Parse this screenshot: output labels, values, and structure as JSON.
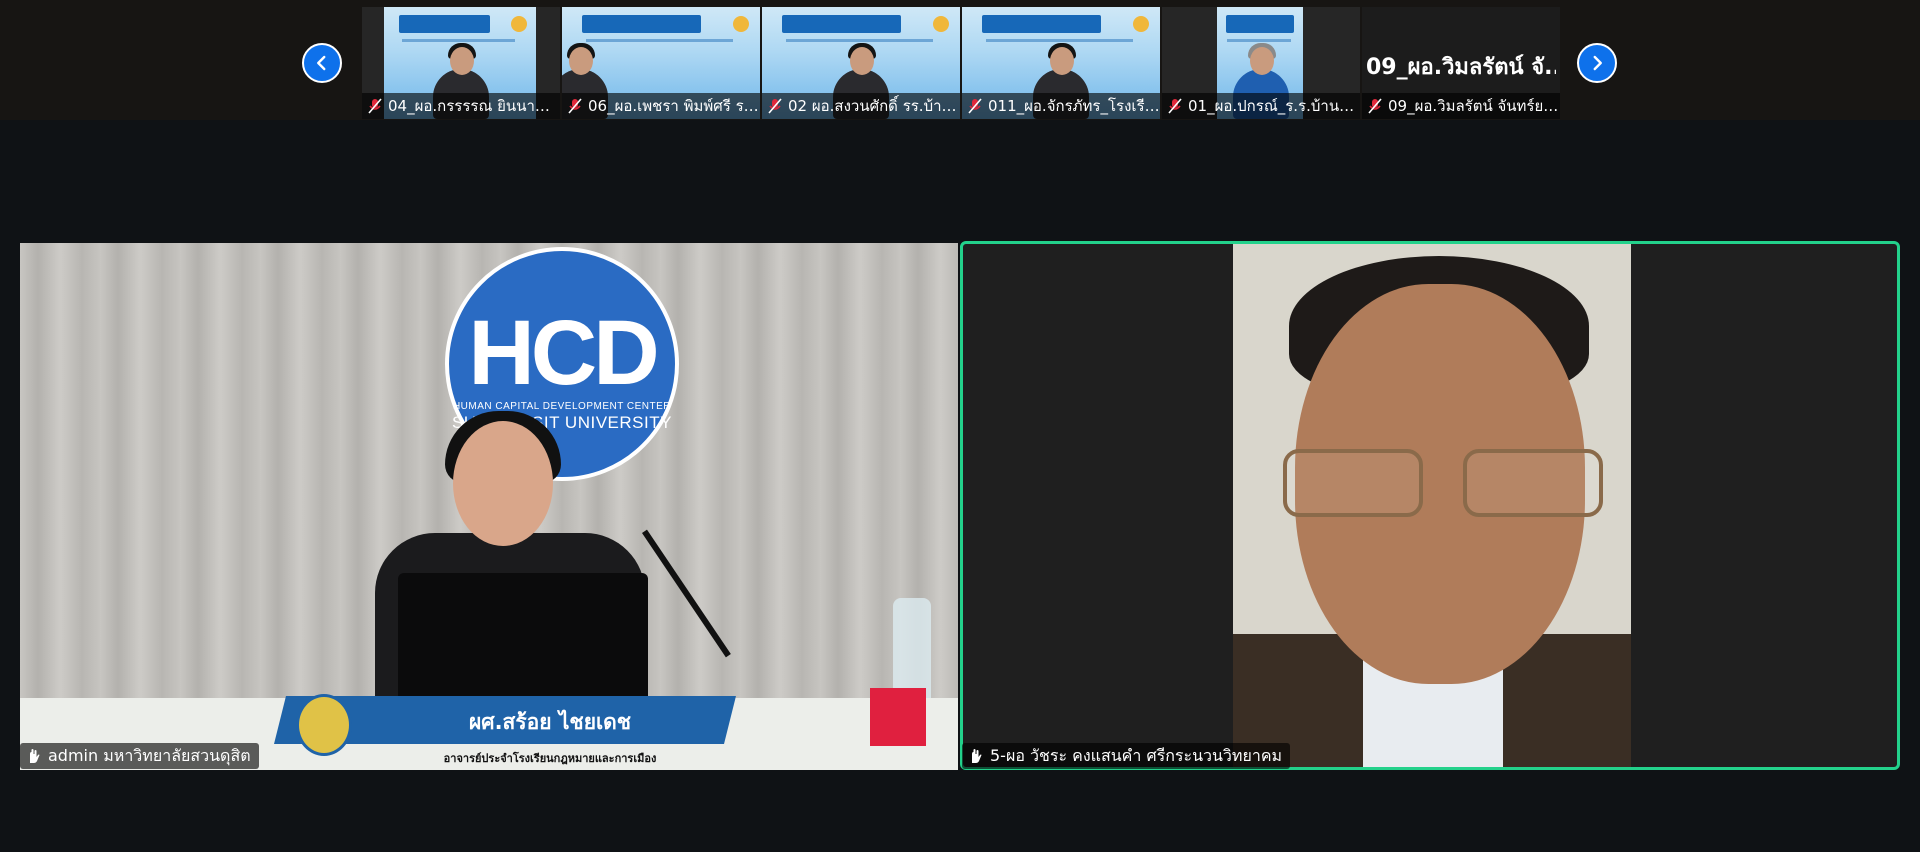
{
  "filmstrip": {
    "participants": [
      {
        "name": "04_ผอ.กรรรรณ ยินนาน_...",
        "muted": true,
        "kind": "slide-person"
      },
      {
        "name": "06_ผอ.เพชรา พิมพ์ศรี ร.ร...",
        "muted": true,
        "kind": "slide"
      },
      {
        "name": "02 ผอ.สงวนศักดิ์ รร.บ้านโ...",
        "muted": true,
        "kind": "slide-person"
      },
      {
        "name": "011_ผอ.จักรภัทร_โรงเรีย...",
        "muted": true,
        "kind": "slide-person"
      },
      {
        "name": "01_ผอ.ปกรณ์_ร.ร.บ้านสว้า",
        "muted": true,
        "kind": "slide-person"
      },
      {
        "name": "09_ผอ.วิมลรัตน์ จันทร์ยาง...",
        "muted": true,
        "kind": "name-only",
        "big_name": "09_ผอ.วิมลรัตน์ จั..."
      }
    ]
  },
  "main_left": {
    "label": "admin มหาวิทยาลัยสวนดุสิต",
    "logo": {
      "text": "HCD",
      "sub1": "HUMAN CAPITAL DEVELOPMENT CENTER",
      "sub2": "SUAN DUSIT UNIVERSITY"
    },
    "nameplate": {
      "name": "ผศ.สร้อย  ไชยเดช",
      "role": "อาจารย์ประจำโรงเรียนกฎหมายและการเมือง"
    }
  },
  "main_right": {
    "label": "5-ผอ วัชระ คงแสนคำ ศรีกระนวนวิทยาคม",
    "active_speaker": true
  },
  "colors": {
    "accent": "#0e71eb",
    "active_border": "#23d18b",
    "muted_icon": "#e0283a"
  },
  "icons": {
    "prev": "chevron-left-icon",
    "next": "chevron-right-icon",
    "muted": "mic-muted-icon",
    "raise": "hand-icon"
  }
}
